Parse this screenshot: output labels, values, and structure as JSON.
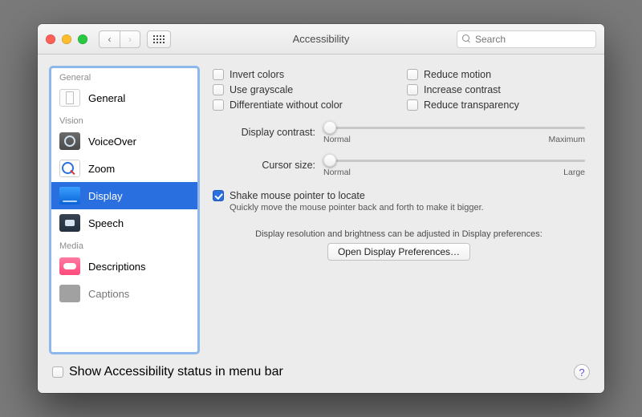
{
  "window": {
    "title": "Accessibility",
    "search_placeholder": "Search"
  },
  "sidebar": {
    "sections": [
      {
        "header": "General",
        "items": [
          {
            "label": "General",
            "icon": "general",
            "selected": false
          }
        ]
      },
      {
        "header": "Vision",
        "items": [
          {
            "label": "VoiceOver",
            "icon": "voiceover",
            "selected": false
          },
          {
            "label": "Zoom",
            "icon": "zoom",
            "selected": false
          },
          {
            "label": "Display",
            "icon": "display",
            "selected": true
          },
          {
            "label": "Speech",
            "icon": "speech",
            "selected": false
          }
        ]
      },
      {
        "header": "Media",
        "items": [
          {
            "label": "Descriptions",
            "icon": "descriptions",
            "selected": false
          },
          {
            "label": "Captions",
            "icon": "captions",
            "selected": false
          }
        ]
      }
    ]
  },
  "pane": {
    "checkboxes": {
      "invert_colors": {
        "label": "Invert colors",
        "checked": false
      },
      "use_grayscale": {
        "label": "Use grayscale",
        "checked": false
      },
      "diff_without_color": {
        "label": "Differentiate without color",
        "checked": false
      },
      "reduce_motion": {
        "label": "Reduce motion",
        "checked": false
      },
      "increase_contrast": {
        "label": "Increase contrast",
        "checked": false
      },
      "reduce_transparency": {
        "label": "Reduce transparency",
        "checked": false
      }
    },
    "sliders": {
      "contrast": {
        "label": "Display contrast:",
        "min_label": "Normal",
        "max_label": "Maximum",
        "value_pct": 0
      },
      "cursor": {
        "label": "Cursor size:",
        "min_label": "Normal",
        "max_label": "Large",
        "value_pct": 0
      }
    },
    "shake": {
      "label": "Shake mouse pointer to locate",
      "checked": true,
      "description": "Quickly move the mouse pointer back and forth to make it bigger."
    },
    "resolution_note": "Display resolution and brightness can be adjusted in Display preferences:",
    "open_button": "Open Display Preferences…"
  },
  "footer": {
    "status_checkbox": {
      "label": "Show Accessibility status in menu bar",
      "checked": false
    },
    "help": "?"
  }
}
